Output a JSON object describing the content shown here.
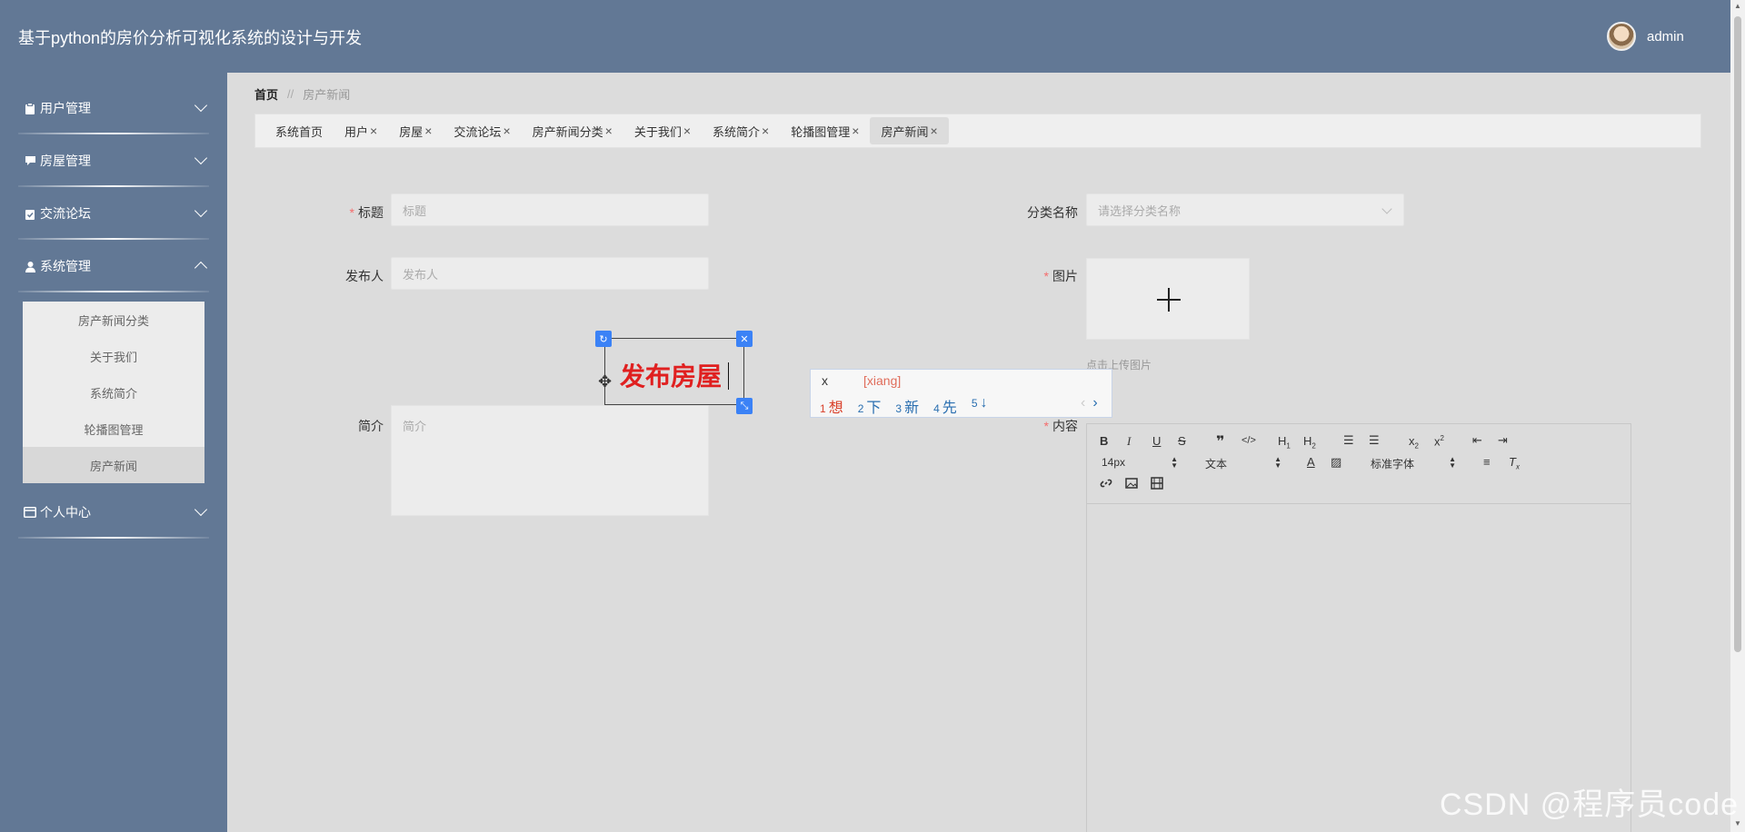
{
  "header": {
    "title": "基于python的房价分析可视化系统的设计与开发",
    "username": "admin"
  },
  "sidebar": {
    "items": [
      {
        "label": "用户管理",
        "icon": "clipboard-icon"
      },
      {
        "label": "房屋管理",
        "icon": "chat-icon"
      },
      {
        "label": "交流论坛",
        "icon": "checklist-icon"
      },
      {
        "label": "系统管理",
        "icon": "user-icon"
      },
      {
        "label": "个人中心",
        "icon": "card-icon"
      }
    ],
    "submenu": [
      "房产新闻分类",
      "关于我们",
      "系统简介",
      "轮播图管理",
      "房产新闻"
    ]
  },
  "breadcrumb": {
    "home": "首页",
    "separator": "//",
    "current": "房产新闻"
  },
  "tabs": [
    "系统首页",
    "用户",
    "房屋",
    "交流论坛",
    "房产新闻分类",
    "关于我们",
    "系统简介",
    "轮播图管理",
    "房产新闻"
  ],
  "tab_close": "×",
  "form": {
    "title_label": "标题",
    "title_placeholder": "标题",
    "category_label": "分类名称",
    "category_placeholder": "请选择分类名称",
    "publisher_label": "发布人",
    "publisher_placeholder": "发布人",
    "image_label": "图片",
    "upload_hint": "点击上传图片",
    "intro_label": "简介",
    "intro_placeholder": "简介",
    "content_label": "内容",
    "required_mark": "*"
  },
  "editor": {
    "font_size": "14px",
    "block_format": "文本",
    "font_family": "标准字体"
  },
  "overlay": {
    "text": "发布房屋",
    "ime_input": "x",
    "ime_pinyin": "[xiang]",
    "candidates": [
      {
        "num": "1",
        "char": "想"
      },
      {
        "num": "2",
        "char": "下"
      },
      {
        "num": "3",
        "char": "新"
      },
      {
        "num": "4",
        "char": "先"
      },
      {
        "num": "5",
        "char": "↓"
      }
    ]
  },
  "watermark": "CSDN @程序员code",
  "colors": {
    "header_bg": "#627895",
    "content_bg": "#dcdcdc",
    "accent": "#3b82f6",
    "required": "#f56c6c"
  }
}
